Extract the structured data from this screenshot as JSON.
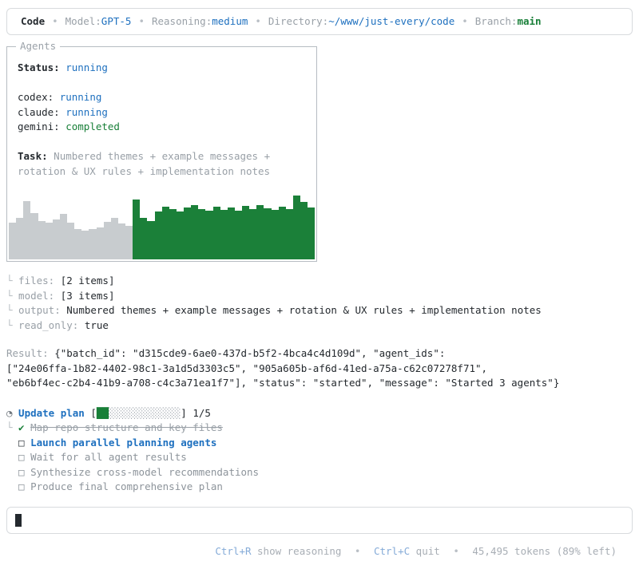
{
  "header": {
    "app_name": "Code",
    "separator": "•",
    "model_label": "Model:",
    "model_value": "GPT-5",
    "reasoning_label": "Reasoning:",
    "reasoning_value": "medium",
    "directory_label": "Directory:",
    "directory_value": "~/www/just-every/code",
    "branch_label": "Branch:",
    "branch_value": "main"
  },
  "agents_panel": {
    "title": "Agents",
    "status_label": "Status:",
    "status_value": "running",
    "agents": [
      {
        "name": "codex:",
        "state": "running"
      },
      {
        "name": "claude:",
        "state": "running"
      },
      {
        "name": "gemini:",
        "state": "completed"
      }
    ],
    "task_label": "Task:",
    "task_value": "Numbered themes + example messages + rotation & UX rules + implementation notes"
  },
  "chart_data": {
    "type": "bar",
    "title": "agent activity sparkline",
    "values": [
      46,
      52,
      73,
      58,
      48,
      46,
      50,
      57,
      46,
      38,
      36,
      38,
      40,
      47,
      52,
      45,
      42,
      75,
      52,
      48,
      60,
      66,
      63,
      60,
      65,
      68,
      63,
      61,
      66,
      62,
      65,
      61,
      67,
      63,
      68,
      64,
      62,
      66,
      63,
      80,
      72,
      65
    ],
    "split_index": 17,
    "colors": {
      "inactive": "#c8cccf",
      "active": "#1b8039"
    },
    "ylim": [
      0,
      80
    ]
  },
  "details": {
    "connector": "└",
    "rows": [
      {
        "label": "files:",
        "value": "[2 items]"
      },
      {
        "label": "model:",
        "value": "[3 items]"
      },
      {
        "label": "output:",
        "value": "Numbered themes + example messages + rotation & UX rules + implementation notes"
      },
      {
        "label": "read_only:",
        "value": "true"
      }
    ]
  },
  "result": {
    "label": "Result:",
    "lines": [
      "{\"batch_id\": \"d315cde9-6ae0-437d-b5f2-4bca4c4d109d\", \"agent_ids\":",
      "[\"24e06ffa-1b82-4402-98c1-3a1d5d3303c5\", \"905a605b-af6d-41ed-a75a-c62c07278f71\",",
      "\"eb6bf4ec-c2b4-41b9-a708-c4c3a71ea1f7\"], \"status\": \"started\", \"message\": \"Started 3 agents\"}"
    ]
  },
  "plan": {
    "spinner_icon": "◔",
    "title": "Update plan",
    "bracket_open": "[",
    "bracket_close": "]",
    "bar_filled": "██",
    "bar_empty": "░░░░░░░░░░░░",
    "fraction": "1/5",
    "connector": "└",
    "check_glyph": "✔",
    "box_glyph": "□",
    "items": [
      {
        "label": "Map repo structure and key files",
        "state": "done"
      },
      {
        "label": "Launch parallel planning agents",
        "state": "active"
      },
      {
        "label": "Wait for all agent results",
        "state": "pending"
      },
      {
        "label": "Synthesize cross-model recommendations",
        "state": "pending"
      },
      {
        "label": "Produce final comprehensive plan",
        "state": "pending"
      }
    ]
  },
  "composer": {
    "value": ""
  },
  "footer": {
    "shortcut_reasoning_key": "Ctrl+R",
    "shortcut_reasoning_label": "show reasoning",
    "separator": "•",
    "shortcut_quit_key": "Ctrl+C",
    "shortcut_quit_label": "quit",
    "tokens_text": "45,495 tokens (89% left)"
  }
}
